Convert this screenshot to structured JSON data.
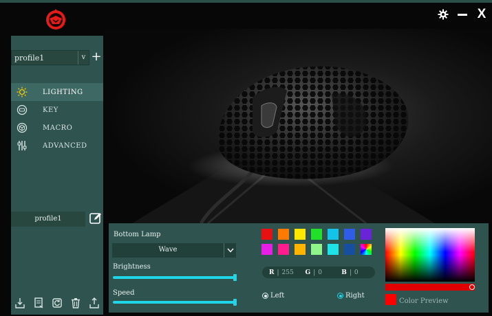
{
  "window": {
    "controls": [
      "gear-icon",
      "minimize-icon",
      "close-icon"
    ],
    "close_label": "X"
  },
  "colors": {
    "accent": "#1fd6e8",
    "sidebar": "#2f5450",
    "logo_red": "#e31b1b"
  },
  "sidebar": {
    "profile_select": "profile1",
    "profile_arrow": "v",
    "add_label": "+",
    "nav": [
      {
        "label": "LIGHTING",
        "icon": "sun-icon",
        "active": true
      },
      {
        "label": "KEY",
        "icon": "key-icon",
        "active": false
      },
      {
        "label": "MACRO",
        "icon": "cube-icon",
        "active": false
      },
      {
        "label": "ADVANCED",
        "icon": "sliders-icon",
        "active": false
      }
    ],
    "profile_name": "profile1",
    "tools": [
      "import-icon",
      "export-icon",
      "reset-icon",
      "delete-icon",
      "apply-icon"
    ]
  },
  "lighting": {
    "lamp_label": "Bottom Lamp",
    "mode": "Wave",
    "brightness_label": "Brightness",
    "brightness_value": 1.0,
    "speed_label": "Speed",
    "speed_value": 1.0,
    "swatches": [
      "#e81010",
      "#ff7a00",
      "#ffe800",
      "#22e02a",
      "#14c3e8",
      "#2f5de8",
      "#6a24d8",
      "#e61ee6",
      "#ff1c8c",
      "#ffb400",
      "#8ff58a",
      "#1ee3e8",
      "#164fa0",
      "rainbow"
    ],
    "rgb": {
      "r_label": "R",
      "r": "255",
      "g_label": "G",
      "g": "0",
      "b_label": "B",
      "b": "0"
    },
    "direction_left": "Left",
    "direction_right": "Right",
    "direction": "Right",
    "preview_color": "#ff0000",
    "preview_label": "Color Preview",
    "luminance": 1.0
  }
}
